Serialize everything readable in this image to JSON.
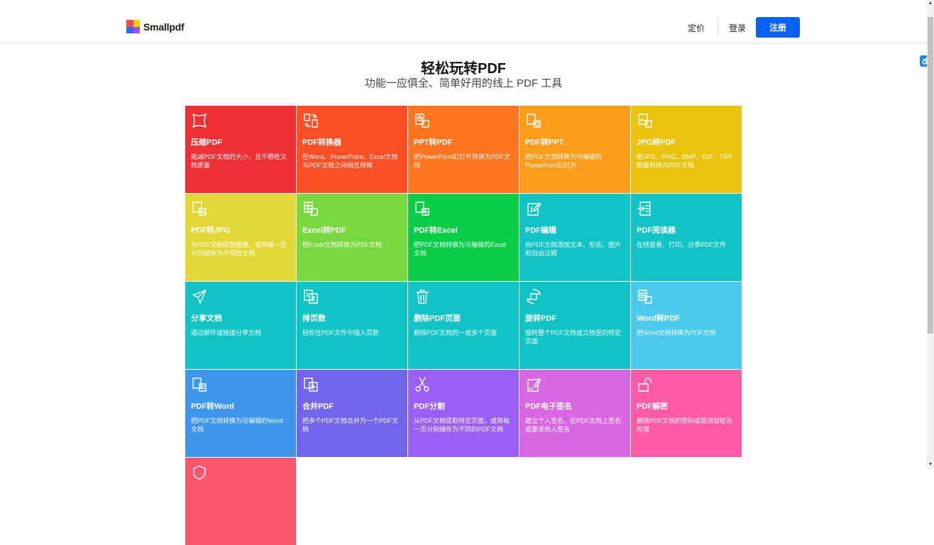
{
  "header": {
    "brand": "Smallpdf",
    "nav_pricing": "定价",
    "nav_login": "登录",
    "signup_label": "注册"
  },
  "hero": {
    "title": "轻松玩转PDF",
    "subtitle": "功能一应俱全、简单好用的线上 PDF 工具"
  },
  "logo_colors": [
    "#ff4d4d",
    "#ffcc00",
    "#2b6cff",
    "#9c4dff"
  ],
  "tools": [
    {
      "title": "压缩PDF",
      "desc": "缩减PDF文档的大小，且不牺牲文档质量",
      "color": "#ee2f33",
      "icon": "compress-icon"
    },
    {
      "title": "PDF转换器",
      "desc": "在Word、PowerPoint、Excel文档与PDF文档之间相互转换",
      "color": "#fd4f25",
      "icon": "convert-icon"
    },
    {
      "title": "PPT转PDF",
      "desc": "把PowerPoint幻灯片转换为PDF文档",
      "color": "#fd7520",
      "icon": "ppt-to-pdf-icon"
    },
    {
      "title": "PDF转PPT",
      "desc": "把PDF文档转换为可编辑的PowerPoint幻灯片",
      "color": "#fd9b1b",
      "icon": "pdf-to-ppt-icon"
    },
    {
      "title": "JPG转PDF",
      "desc": "把JPG、PNG、BMP、GIF、TIFF图像转换为PDF文档",
      "color": "#e9c30f",
      "icon": "jpg-to-pdf-icon"
    },
    {
      "title": "PDF转JPG",
      "desc": "从PDF文档提取图像，或将每一页分别储存为不同的文档",
      "color": "#e2d737",
      "icon": "pdf-to-jpg-icon"
    },
    {
      "title": "Excel转PDF",
      "desc": "把Excel文档转换为PDF文档",
      "color": "#79d83f",
      "icon": "excel-to-pdf-icon"
    },
    {
      "title": "PDF转Excel",
      "desc": "把PDF文档转换为可编辑的Excel文档",
      "color": "#09cd46",
      "icon": "pdf-to-excel-icon"
    },
    {
      "title": "PDF编辑",
      "desc": "向PDF文档添加文本、形状、图片和自由注释",
      "color": "#12c3c5",
      "icon": "edit-icon"
    },
    {
      "title": "PDF阅读器",
      "desc": "在线查看，打印，分享PDF文件",
      "color": "#12c3c5",
      "icon": "reader-icon"
    },
    {
      "title": "分享文档",
      "desc": "通过邮件或链接分享文档",
      "color": "#12c3c5",
      "icon": "send-icon"
    },
    {
      "title": "排页数",
      "desc": "轻松在PDF文件中插入页数",
      "color": "#12c3c5",
      "icon": "page-numbers-icon"
    },
    {
      "title": "删除PDF页面",
      "desc": "删除PDF文档的一或多个页面",
      "color": "#12c3c5",
      "icon": "trash-icon"
    },
    {
      "title": "旋转PDF",
      "desc": "旋转整个PDF文档或文档里的特定页面",
      "color": "#12c3c5",
      "icon": "rotate-icon"
    },
    {
      "title": "Word转PDF",
      "desc": "把Word文档转换为PDF文档",
      "color": "#4bc9ef",
      "icon": "word-to-pdf-icon"
    },
    {
      "title": "PDF转Word",
      "desc": "把PDF文档转换为可编辑的Word文档",
      "color": "#3f96ef",
      "icon": "pdf-to-word-icon"
    },
    {
      "title": "合并PDF",
      "desc": "把多个PDF文档合并为一个PDF文档",
      "color": "#7265ec",
      "icon": "merge-icon"
    },
    {
      "title": "PDF分割",
      "desc": "从PDF文档提取特定页面，或将每一页分别储存为不同的PDF文档",
      "color": "#9b5ff7",
      "icon": "scissors-icon"
    },
    {
      "title": "PDF电子签名",
      "desc": "建立个人签名，在PDF文档上签名或要求他人签名",
      "color": "#d967e3",
      "icon": "sign-icon"
    },
    {
      "title": "PDF解密",
      "desc": "删除PDF文档的密码或取消加密及权限",
      "color": "#fd5ba6",
      "icon": "unlock-icon"
    },
    {
      "title": "",
      "desc": "",
      "color": "#fd5470",
      "icon": "protect-icon"
    }
  ]
}
